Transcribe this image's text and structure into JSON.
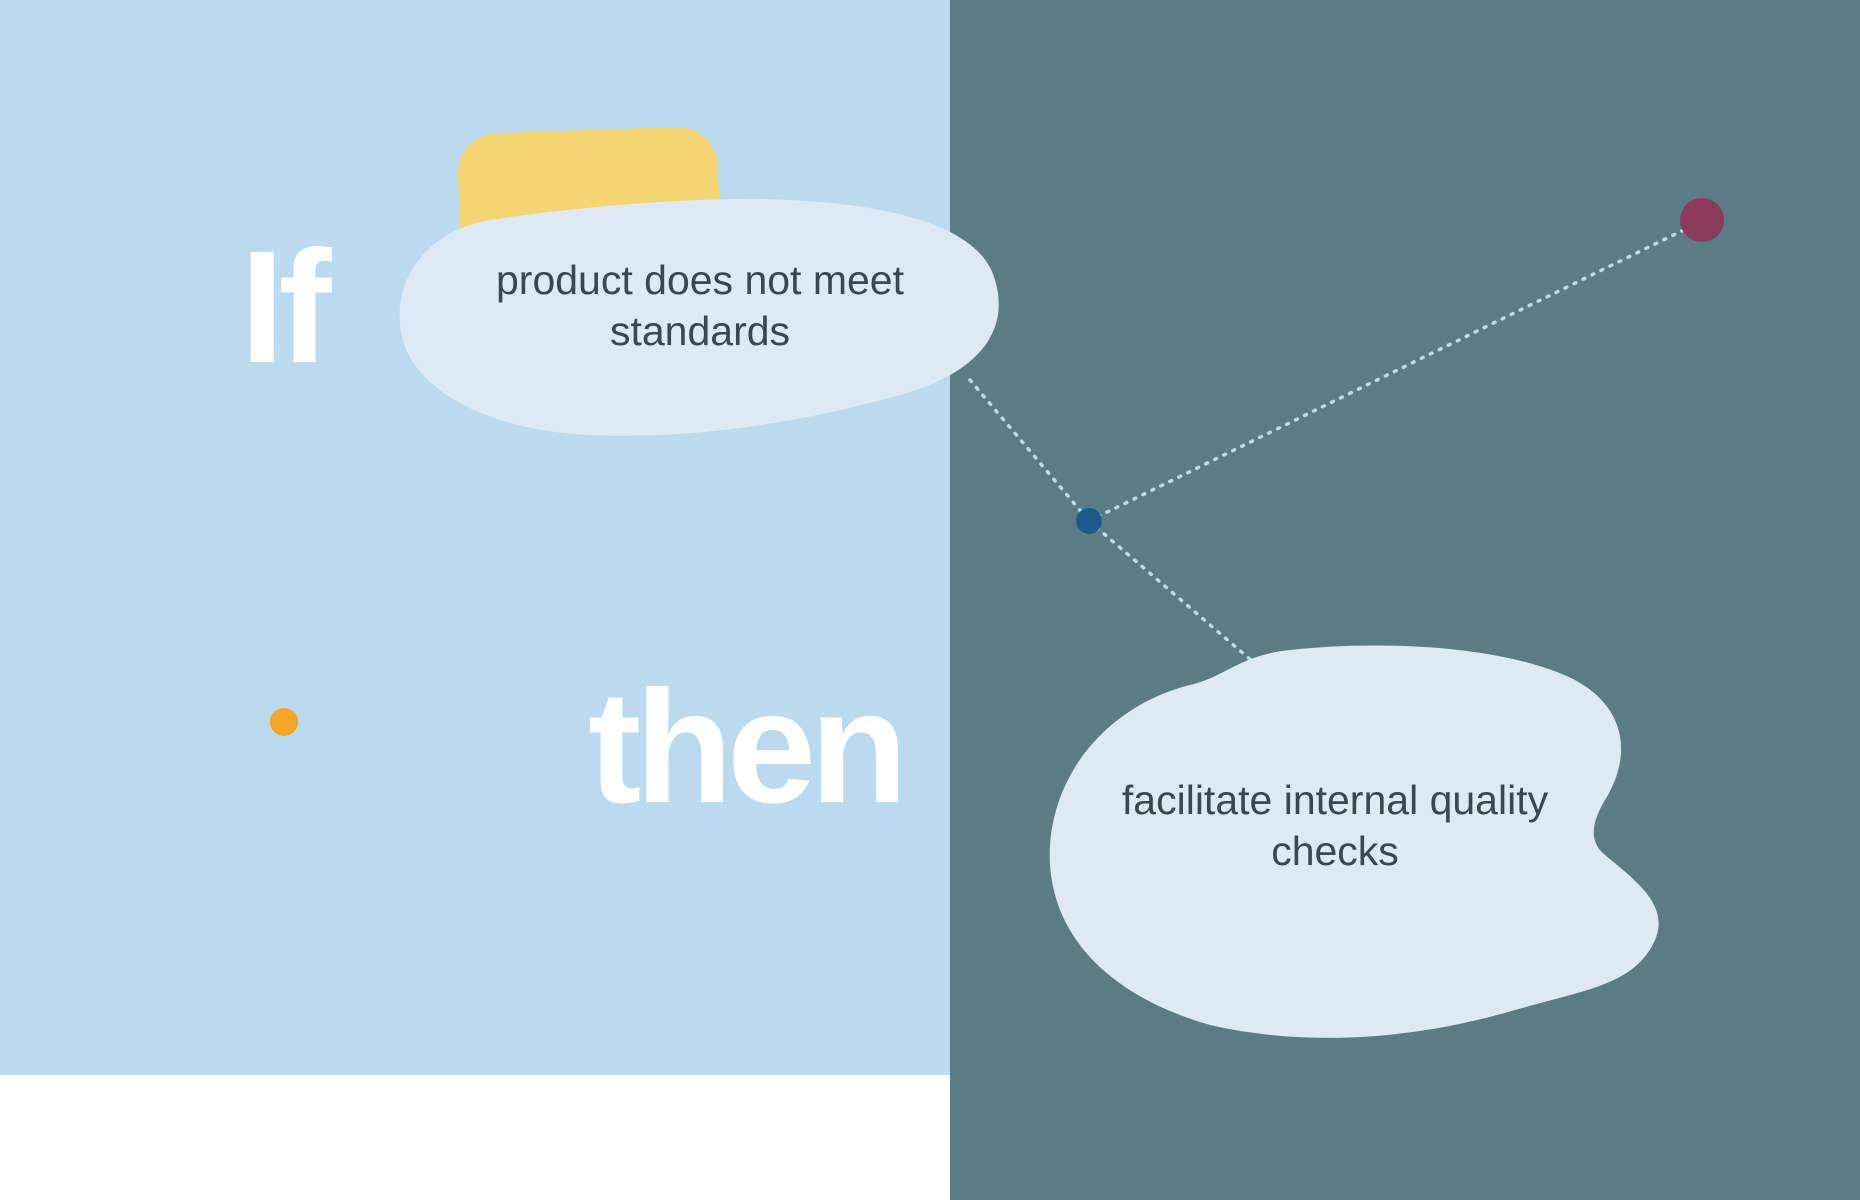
{
  "labels": {
    "if": "If",
    "then": "then"
  },
  "condition": {
    "text": "product does not meet standards"
  },
  "action": {
    "text": "facilitate internal quality checks"
  },
  "colors": {
    "left_bg": "#bbd9ef",
    "right_bg": "#5b7c87",
    "blob_fill": "#dde9f4",
    "yellow_shape": "#f5d572",
    "orange_dot": "#f5a623",
    "maroon_dot": "#8e3a5c",
    "blue_dot": "#1e5a8e",
    "text_dark": "#3a4752",
    "label_white": "#ffffff"
  }
}
